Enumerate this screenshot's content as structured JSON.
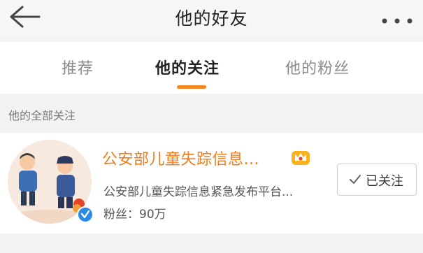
{
  "header": {
    "title": "他的好友",
    "back_icon": "back-arrow-icon",
    "more_icon": "more-dots-icon"
  },
  "tabs": [
    {
      "label": "推荐",
      "active": false
    },
    {
      "label": "他的关注",
      "active": true
    },
    {
      "label": "他的粉丝",
      "active": false
    }
  ],
  "section": {
    "title": "他的全部关注"
  },
  "follow_list": [
    {
      "name": "公安部儿童失踪信息...",
      "description": "公安部儿童失踪信息紧急发布平台...",
      "fans": "粉丝：90万",
      "verified": true,
      "follow_label": "已关注",
      "follow_icon": "check-icon"
    }
  ],
  "colors": {
    "accent": "#f5871f",
    "name": "#f07d1c",
    "verified": "#2a8ae6"
  }
}
